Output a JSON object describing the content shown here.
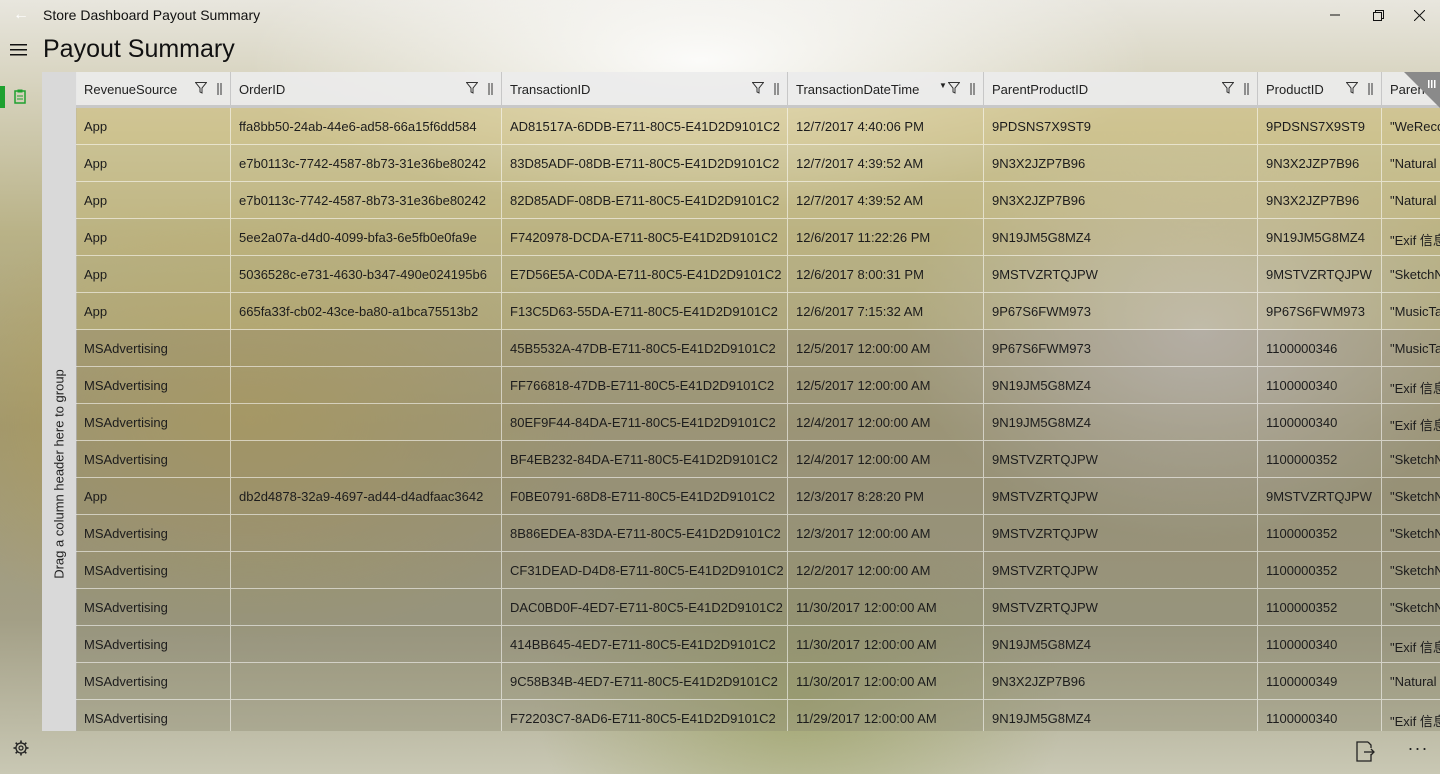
{
  "window": {
    "title": "Store Dashboard Payout Summary",
    "back_glyph": "←"
  },
  "page": {
    "title": "Payout Summary"
  },
  "group_panel": {
    "text": "Drag a column header here to group"
  },
  "grid": {
    "columns": [
      {
        "label": "RevenueSource",
        "sorted": false
      },
      {
        "label": "OrderID",
        "sorted": false
      },
      {
        "label": "TransactionID",
        "sorted": false
      },
      {
        "label": "TransactionDateTime",
        "sorted": true,
        "sort_glyph": "▼"
      },
      {
        "label": "ParentProductID",
        "sorted": false
      },
      {
        "label": "ProductID",
        "sorted": false
      },
      {
        "label": "ParentP",
        "sorted": false
      }
    ],
    "rows": [
      [
        "App",
        "ffa8bb50-24ab-44e6-ad58-66a15f6dd584",
        "AD81517A-6DDB-E711-80C5-E41D2D9101C2",
        "12/7/2017 4:40:06 PM",
        "9PDSNS7X9ST9",
        "9PDSNS7X9ST9",
        "\"WeRecor"
      ],
      [
        "App",
        "e7b0113c-7742-4587-8b73-31e36be80242",
        "83D85ADF-08DB-E711-80C5-E41D2D9101C2",
        "12/7/2017 4:39:52 AM",
        "9N3X2JZP7B96",
        "9N3X2JZP7B96",
        "\"Natural"
      ],
      [
        "App",
        "e7b0113c-7742-4587-8b73-31e36be80242",
        "82D85ADF-08DB-E711-80C5-E41D2D9101C2",
        "12/7/2017 4:39:52 AM",
        "9N3X2JZP7B96",
        "9N3X2JZP7B96",
        "\"Natural"
      ],
      [
        "App",
        "5ee2a07a-d4d0-4099-bfa3-6e5fb0e0fa9e",
        "F7420978-DCDA-E711-80C5-E41D2D9101C2",
        "12/6/2017 11:22:26 PM",
        "9N19JM5G8MZ4",
        "9N19JM5G8MZ4",
        "\"Exif 信息"
      ],
      [
        "App",
        "5036528c-e731-4630-b347-490e024195b6",
        "E7D56E5A-C0DA-E711-80C5-E41D2D9101C2",
        "12/6/2017 8:00:31 PM",
        "9MSTVZRTQJPW",
        "9MSTVZRTQJPW",
        "\"SketchN"
      ],
      [
        "App",
        "665fa33f-cb02-43ce-ba80-a1bca75513b2",
        "F13C5D63-55DA-E711-80C5-E41D2D9101C2",
        "12/6/2017 7:15:32 AM",
        "9P67S6FWM973",
        "9P67S6FWM973",
        "\"MusicTa"
      ],
      [
        "MSAdvertising",
        "",
        "45B5532A-47DB-E711-80C5-E41D2D9101C2",
        "12/5/2017 12:00:00 AM",
        "9P67S6FWM973",
        "1100000346",
        "\"MusicTa"
      ],
      [
        "MSAdvertising",
        "",
        "FF766818-47DB-E711-80C5-E41D2D9101C2",
        "12/5/2017 12:00:00 AM",
        "9N19JM5G8MZ4",
        "1100000340",
        "\"Exif 信息"
      ],
      [
        "MSAdvertising",
        "",
        "80EF9F44-84DA-E711-80C5-E41D2D9101C2",
        "12/4/2017 12:00:00 AM",
        "9N19JM5G8MZ4",
        "1100000340",
        "\"Exif 信息"
      ],
      [
        "MSAdvertising",
        "",
        "BF4EB232-84DA-E711-80C5-E41D2D9101C2",
        "12/4/2017 12:00:00 AM",
        "9MSTVZRTQJPW",
        "1100000352",
        "\"SketchN"
      ],
      [
        "App",
        "db2d4878-32a9-4697-ad44-d4adfaac3642",
        "F0BE0791-68D8-E711-80C5-E41D2D9101C2",
        "12/3/2017 8:28:20 PM",
        "9MSTVZRTQJPW",
        "9MSTVZRTQJPW",
        "\"SketchN"
      ],
      [
        "MSAdvertising",
        "",
        "8B86EDEA-83DA-E711-80C5-E41D2D9101C2",
        "12/3/2017 12:00:00 AM",
        "9MSTVZRTQJPW",
        "1100000352",
        "\"SketchN"
      ],
      [
        "MSAdvertising",
        "",
        "CF31DEAD-D4D8-E711-80C5-E41D2D9101C2",
        "12/2/2017 12:00:00 AM",
        "9MSTVZRTQJPW",
        "1100000352",
        "\"SketchN"
      ],
      [
        "MSAdvertising",
        "",
        "DAC0BD0F-4ED7-E711-80C5-E41D2D9101C2",
        "11/30/2017 12:00:00 AM",
        "9MSTVZRTQJPW",
        "1100000352",
        "\"SketchN"
      ],
      [
        "MSAdvertising",
        "",
        "414BB645-4ED7-E711-80C5-E41D2D9101C2",
        "11/30/2017 12:00:00 AM",
        "9N19JM5G8MZ4",
        "1100000340",
        "\"Exif 信息"
      ],
      [
        "MSAdvertising",
        "",
        "9C58B34B-4ED7-E711-80C5-E41D2D9101C2",
        "11/30/2017 12:00:00 AM",
        "9N3X2JZP7B96",
        "1100000349",
        "\"Natural"
      ],
      [
        "MSAdvertising",
        "",
        "F72203C7-8AD6-E711-80C5-E41D2D9101C2",
        "11/29/2017 12:00:00 AM",
        "9N19JM5G8MZ4",
        "1100000340",
        "\"Exif 信息"
      ]
    ]
  },
  "icons": {
    "back": "back-arrow-icon",
    "menu": "hamburger-icon",
    "nav_item": "clipboard-icon",
    "settings": "gear-icon",
    "export": "export-file-icon",
    "more": "more-ellipsis-icon",
    "column_chooser": "column-chooser-icon"
  },
  "colors": {
    "accent": "#1ea12f"
  },
  "more_glyph": "···"
}
